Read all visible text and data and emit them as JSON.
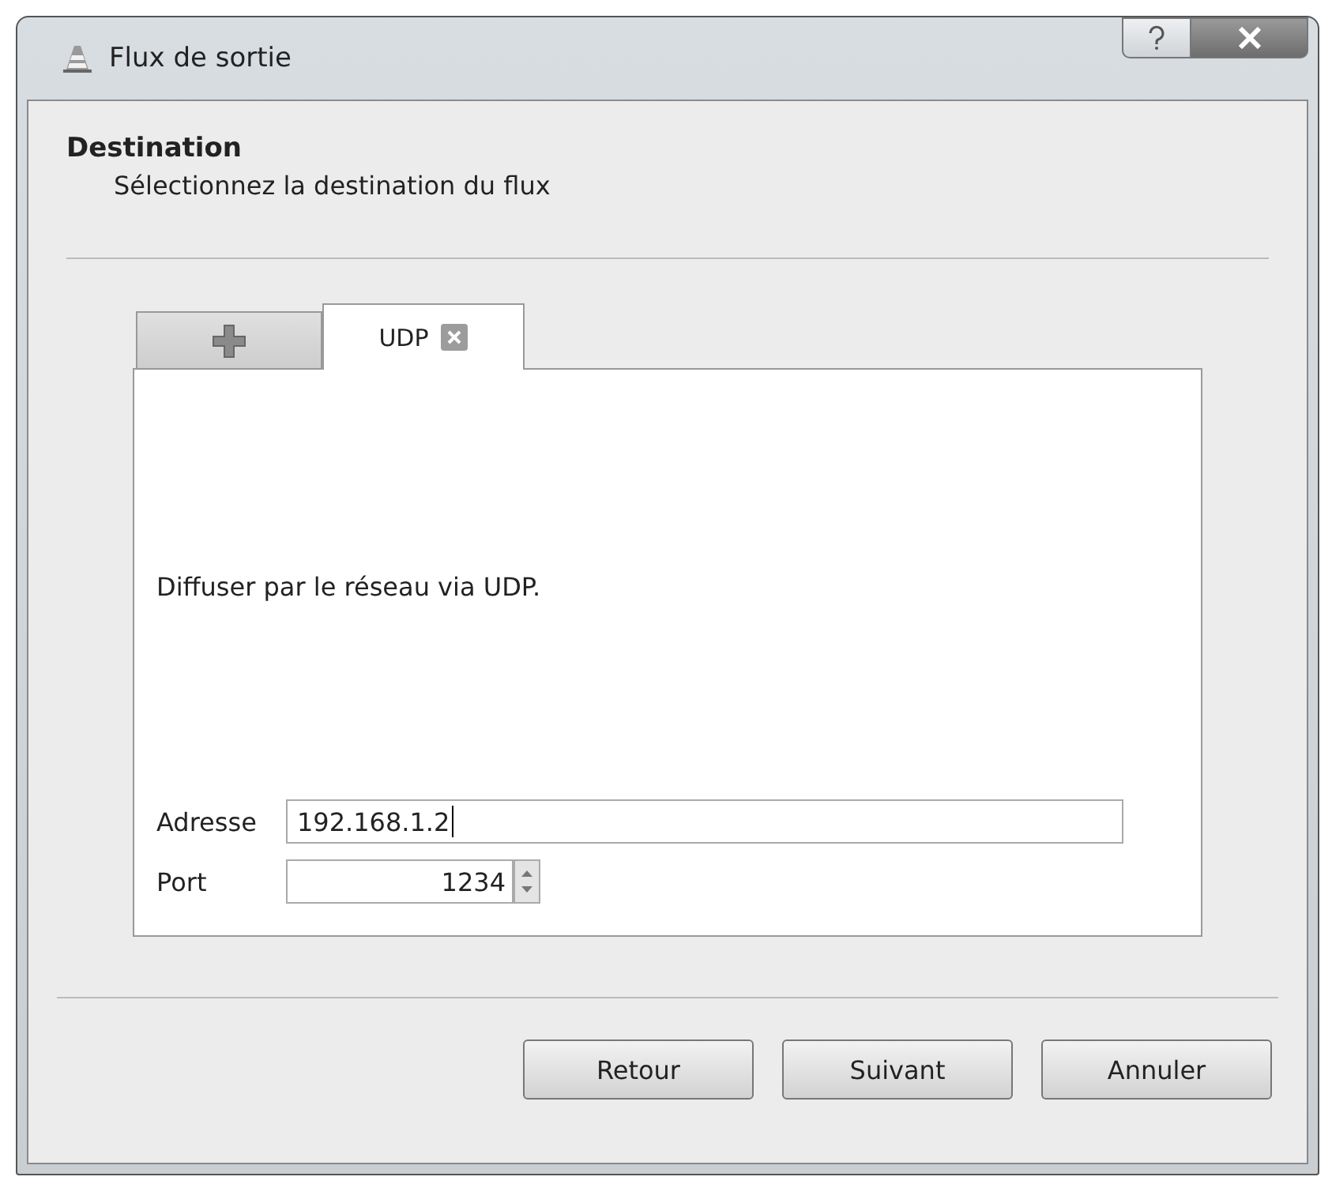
{
  "window": {
    "title": "Flux de sortie"
  },
  "header": {
    "title": "Destination",
    "subtitle": "Sélectionnez la destination du flux"
  },
  "tabs": [
    {
      "kind": "add",
      "selected": false
    },
    {
      "kind": "text",
      "label": "UDP",
      "selected": true,
      "closable": true
    }
  ],
  "panel": {
    "description": "Diffuser par le réseau via UDP.",
    "fields": [
      {
        "kind": "text",
        "label": "Adresse",
        "value": "192.168.1.2"
      },
      {
        "kind": "spin",
        "label": "Port",
        "value": "1234"
      }
    ]
  },
  "buttons": [
    "Retour",
    "Suivant",
    "Annuler"
  ]
}
